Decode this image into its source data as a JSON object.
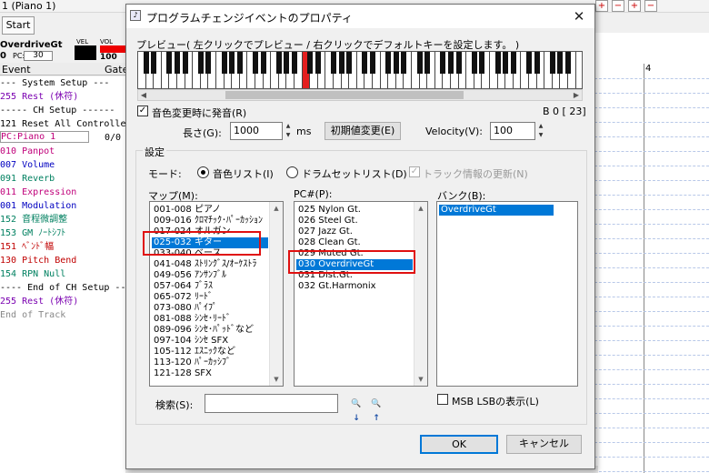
{
  "background": {
    "track_title": "1 (Piano 1)",
    "start_button": "Start",
    "track_name": "OverdriveGt",
    "track_number": "0",
    "pc_label": "PC:",
    "pc_value": "30",
    "vel_label": "VEL",
    "vol_label": "VOL",
    "vol_value": "100",
    "col_event": "Event",
    "col_gate": "Gate",
    "measure_label": "4",
    "events": [
      {
        "text": "--- System Setup ---",
        "color": "#000000"
      },
      {
        "text": "255 Rest (休符)",
        "color": "#7a00b0"
      },
      {
        "text": "----- CH Setup ------",
        "color": "#000000"
      },
      {
        "text": "121 Reset All Controllers",
        "color": "#000000"
      },
      {
        "text": "PC:Piano 1",
        "color": "#c0007a"
      },
      {
        "text": "010 Panpot",
        "color": "#c0007a"
      },
      {
        "text": "007 Volume",
        "color": "#0000c0"
      },
      {
        "text": "091 Reverb",
        "color": "#008060"
      },
      {
        "text": "011 Expression",
        "color": "#c0007a"
      },
      {
        "text": "001 Modulation",
        "color": "#0000c0"
      },
      {
        "text": "152 音程微調整",
        "color": "#008060"
      },
      {
        "text": "153 GM ﾉｰﾄｼﾌﾄ",
        "color": "#008060"
      },
      {
        "text": "151 ﾍﾞﾝﾄﾞ幅",
        "color": "#c00000"
      },
      {
        "text": "130 Pitch Bend",
        "color": "#c00000"
      },
      {
        "text": "154 RPN Null",
        "color": "#008060"
      },
      {
        "text": "---- End of CH Setup --",
        "color": "#000000"
      },
      {
        "text": "255 Rest (休符)",
        "color": "#7a00b0"
      },
      {
        "text": "End of Track",
        "color": "#888888"
      }
    ],
    "event_extra": "0/0"
  },
  "dialog": {
    "title": "プログラムチェンジイベントのプロパティ",
    "close_glyph": "✕",
    "preview_label": "プレビュー( 左クリックでプレビュー / 右クリックでデフォルトキーを設定します。 )",
    "play_on_change_label": "音色変更時に発音(R)",
    "play_on_change_checked": true,
    "note_readout": "B  0 [ 23]",
    "length_label": "長さ(G):",
    "length_value": "1000",
    "length_unit": "ms",
    "reset_button": "初期値変更(E)",
    "velocity_label": "Velocity(V):",
    "velocity_value": "100",
    "settings_label": "設定",
    "mode_label": "モード:",
    "mode_tone": "音色リスト(I)",
    "mode_drum": "ドラムセットリスト(D)",
    "mode_selected": "tone",
    "update_track_label": "トラック情報の更新(N)",
    "map_label": "マップ(M):",
    "pc_label": "PC#(P):",
    "bank_label": "バンク(B):",
    "map_items": [
      "001-008 ピアノ",
      "009-016 ｸﾛﾏﾁｯｸ･ﾊﾟｰｶｯｼｮﾝ",
      "017-024 オルガン",
      "025-032 ギター",
      "033-040 ベース",
      "041-048 ｽﾄﾘﾝｸﾞｽ/ｵｰｹｽﾄﾗ",
      "049-056 ｱﾝｻﾝﾌﾞﾙ",
      "057-064 ﾌﾞﾗｽ",
      "065-072 ﾘｰﾄﾞ",
      "073-080 ﾊﾟｲﾌﾟ",
      "081-088 ｼﾝｾ･ﾘｰﾄﾞ",
      "089-096 ｼﾝｾ･ﾊﾟｯﾄﾞなど",
      "097-104 ｼﾝｾ SFX",
      "105-112 ｴｽﾆｯｸなど",
      "113-120 ﾊﾟｰｶｯｼﾌﾞ",
      "121-128 SFX"
    ],
    "map_selected": 3,
    "pc_items": [
      "025 Nylon Gt.",
      "026 Steel Gt.",
      "027 Jazz Gt.",
      "028 Clean Gt.",
      "029 Muted Gt.",
      "030 OverdriveGt",
      "031 Dist.Gt.",
      "032 Gt.Harmonix"
    ],
    "pc_selected": 5,
    "bank_items": [
      "OverdriveGt"
    ],
    "bank_selected": 0,
    "msb_lsb_label": "MSB LSBの表示(L)",
    "msb_lsb_checked": false,
    "search_label": "検索(S):",
    "search_value": "",
    "ok_button": "OK",
    "cancel_button": "キャンセル",
    "highlight_color": "#e01010",
    "selection_color": "#0078d7",
    "highlight_key_index": 21
  }
}
